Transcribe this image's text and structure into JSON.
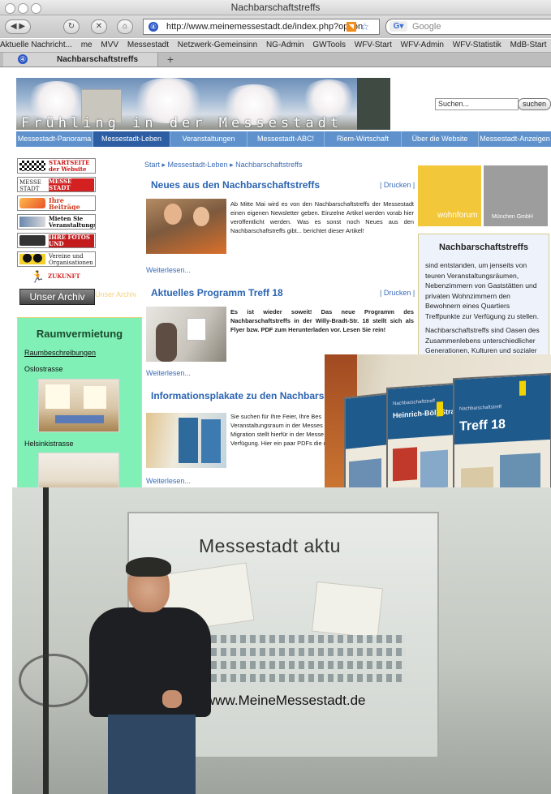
{
  "browser": {
    "window_title": "Nachbarschaftstreffs",
    "url": "http://www.meinemessestadt.de/index.php?option",
    "search_placeholder": "Google",
    "bookmarks": [
      "Aktuelle Nachricht...",
      "me",
      "MVV",
      "Messestadt",
      "Netzwerk-Gemeinsinn",
      "NG-Admin",
      "GWTools",
      "WFV-Start",
      "WFV-Admin",
      "WFV-Statistik",
      "MdB-Start"
    ],
    "tab_title": "Nachbarschaftstreffs",
    "new_tab": "+"
  },
  "header": {
    "banner_text": "Frühling in der Messestadt",
    "search_value": "Suchen...",
    "search_button": "suchen"
  },
  "nav": [
    {
      "label": "Messestadt-Panorama"
    },
    {
      "label": "Messestadt-Leben"
    },
    {
      "label": "Veranstaltungen"
    },
    {
      "label": "Messestadt-ABC!"
    },
    {
      "label": "Riem-Wirtschaft"
    },
    {
      "label": "Über die Website"
    },
    {
      "label": "Messestadt-Anzeigen"
    }
  ],
  "left": {
    "buttons": [
      "STARTSEITE der Website",
      "MESSE STADT KLEINANZEIGEN",
      "Ihre Beiträge Texte, Fotos, etc",
      "Mieten Sie Veranstaltungsräume",
      "IHRE FOTOS UND DIASCHAUEN",
      "Vereine und Organisationen",
      "ZUKUNFT"
    ],
    "archiv": "Unser Archiv",
    "archiv_ghost": "Unser Archiv",
    "raum_title": "Raumvermietung",
    "raum_link": "Raumbeschreibungen",
    "place1": "Oslostrasse",
    "place2": "Helsinkistrasse"
  },
  "center": {
    "breadcrumb": "Start ▸ Messestadt-Leben ▸ Nachbarschaftstreffs",
    "drucken": "| Drucken |",
    "weiter": "Weiterlesen...",
    "articles": [
      {
        "title": "Neues aus den Nachbarschaftstreffs",
        "text": "Ab Mitte Mai wird es von den Nachbarschaftstreffs der Messestadt einen eigenen Newsletter geben. Einzelne Artikel werden vorab hier veröffentlicht werden. Was es sonst noch Neues aus den Nachbarschaftstreffs gibt... berichtet dieser Artikel!"
      },
      {
        "title": "Aktuelles Programm Treff 18",
        "text": "Es ist wieder soweit! Das neue Programm des Nachbarschaftstreffs in der Willy-Bradt-Str. 18 stellt sich als Flyer bzw. PDF zum Herunterladen vor. Lesen Sie rein!"
      },
      {
        "title": "Informationsplakate zu den Nachbarschaftstre",
        "text": "Sie suchen für Ihre Feier, Ihre Bes Veranstaltungsraum in der Messes Migration stellt hierfür in der Messe Verfügung. Hier ein paar PDFs die da"
      }
    ]
  },
  "right": {
    "wohnforum": "wohnforum",
    "muenchen": "München GmbH",
    "box_title": "Nachbarschaftstreffs",
    "box_p1": "sind entstanden, um jenseits von teuren Veranstaltungsräumen, Nebenzimmern von Gaststätten und privaten Wohnzimmern den Bewohnern eines Quartiers Treffpunkte zur Verfügung zu stellen.",
    "box_p2": "Nachbarschaftstreffs sind Oasen des Zusammenlebens unterschiedlicher Generationen, Kulturen und sozialer"
  },
  "photos": {
    "poster1_small": "Nachbarschaftstreff",
    "poster1": "Heinrich-Böll-Straße",
    "poster2_small": "Nachbarschaftstreff",
    "poster2": "Treff 18",
    "showcase_title": "Messestadt aktu",
    "showcase_url": "www.MeineMessestadt.de"
  }
}
